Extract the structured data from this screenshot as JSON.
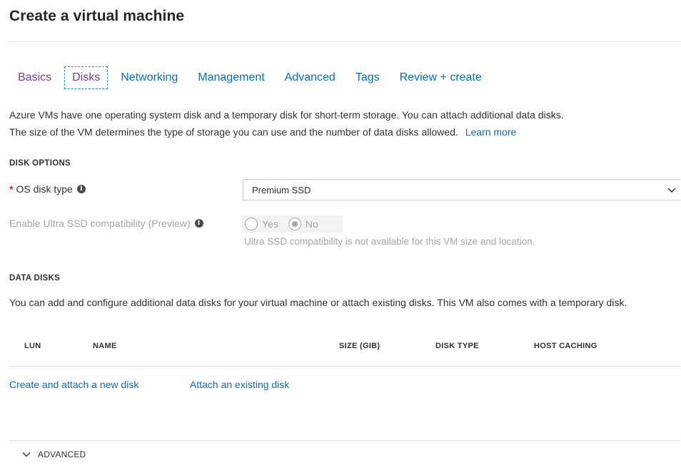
{
  "page": {
    "title": "Create a virtual machine"
  },
  "tabs": [
    {
      "label": "Basics",
      "state": "visited"
    },
    {
      "label": "Disks",
      "state": "active"
    },
    {
      "label": "Networking",
      "state": "default"
    },
    {
      "label": "Management",
      "state": "default"
    },
    {
      "label": "Advanced",
      "state": "default"
    },
    {
      "label": "Tags",
      "state": "default"
    },
    {
      "label": "Review + create",
      "state": "default"
    }
  ],
  "intro": {
    "line1": "Azure VMs have one operating system disk and a temporary disk for short-term storage. You can attach additional data disks.",
    "line2": "The size of the VM determines the type of storage you can use and the number of data disks allowed.",
    "learn_more": "Learn more"
  },
  "disk_options": {
    "header": "DISK OPTIONS",
    "os_disk_type": {
      "required_mark": "*",
      "label": "OS disk type",
      "value": "Premium SSD"
    },
    "ultra_ssd": {
      "label": "Enable Ultra SSD compatibility (Preview)",
      "options": [
        "Yes",
        "No"
      ],
      "selected": "No",
      "note": "Ultra SSD compatibility is not available for this VM size and location."
    }
  },
  "data_disks": {
    "header": "DATA DISKS",
    "description": "You can add and configure additional data disks for your virtual machine or attach existing disks. This VM also comes with a temporary disk.",
    "columns": [
      "LUN",
      "NAME",
      "SIZE (GIB)",
      "DISK TYPE",
      "HOST CACHING"
    ],
    "actions": {
      "create_new": "Create and attach a new disk",
      "attach_existing": "Attach an existing disk"
    }
  },
  "advanced": {
    "label": "ADVANCED"
  },
  "icons": {
    "info": "info-icon",
    "dropdown": "chevron-down-icon",
    "expand": "chevron-down-icon"
  },
  "colors": {
    "link": "#0a6cbf",
    "visited_link": "#7a3b99",
    "required": "#c3272e",
    "disabled_text": "#a6a6a6"
  }
}
